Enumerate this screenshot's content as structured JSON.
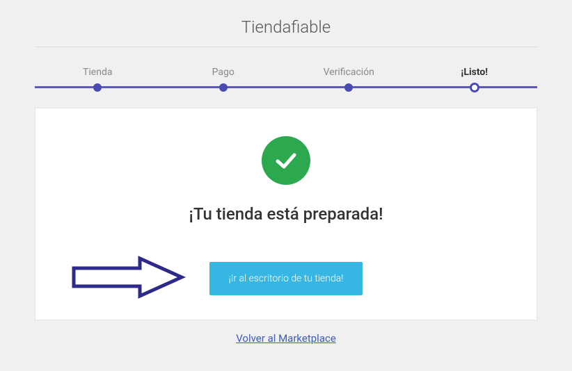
{
  "header": {
    "title": "Tiendafiable"
  },
  "stepper": {
    "steps": [
      {
        "label": "Tienda",
        "active": false
      },
      {
        "label": "Pago",
        "active": false
      },
      {
        "label": "Verificación",
        "active": false
      },
      {
        "label": "¡Listo!",
        "active": true
      }
    ]
  },
  "card": {
    "check_icon": "check-circle",
    "heading": "¡Tu tienda está preparada!",
    "cta_label": "¡Ir al escritorio de tu tienda!"
  },
  "footer": {
    "back_link": "Volver al Marketplace"
  },
  "colors": {
    "accent_stepper": "#5a5ab8",
    "accent_button": "#38b6e3",
    "success": "#2ca84f",
    "arrow_stroke": "#2e2a8a"
  }
}
